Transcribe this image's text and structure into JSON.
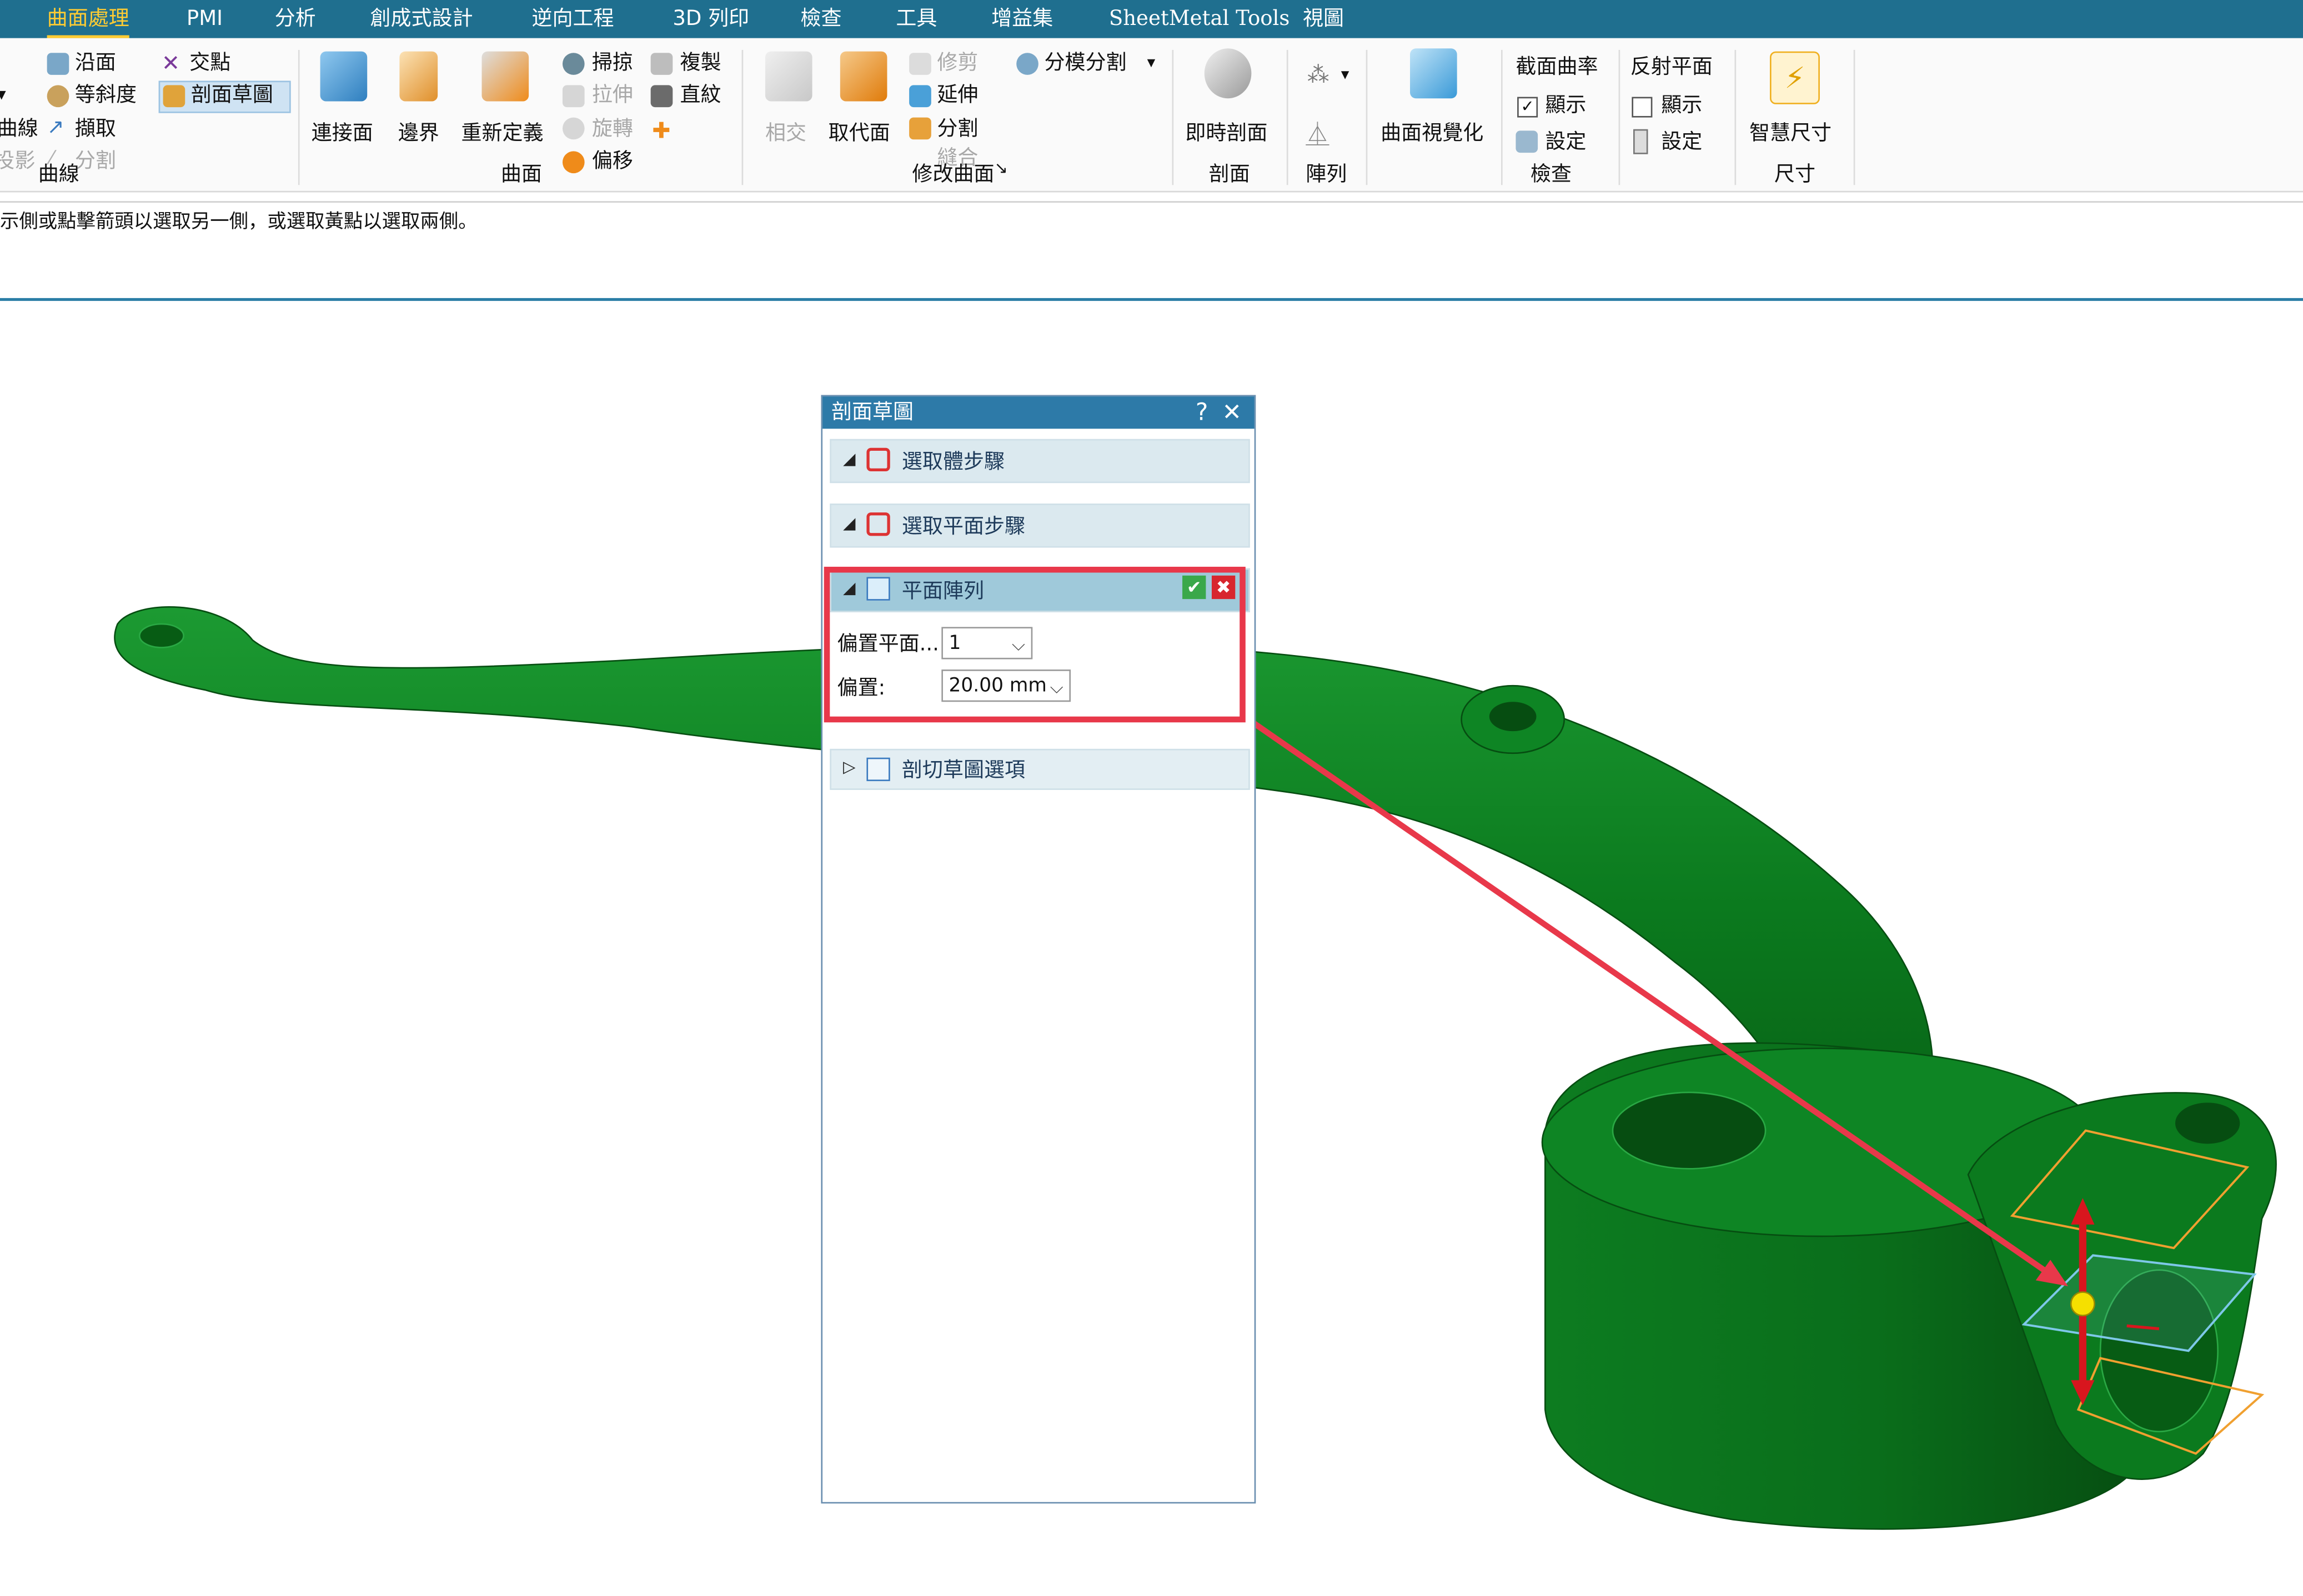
{
  "tabs": [
    "曲面處理",
    "PMI",
    "分析",
    "創成式設計",
    "逆向工程",
    "3D 列印",
    "檢查",
    "工具",
    "增益集",
    "SheetMetal Tools",
    "視圖"
  ],
  "active_tab": "曲面處理",
  "ribbon": {
    "curve_group": {
      "label": "曲線",
      "items": [
        "沿面",
        "交點",
        "等斜度",
        "剖面草圖",
        "擷取",
        "分割"
      ],
      "left_partial": [
        "曲線",
        "投影"
      ],
      "colors": {
        "highlight": "#cfe3f3"
      }
    },
    "surface_group": {
      "label": "曲面",
      "big": [
        "連接面",
        "邊界",
        "重新定義"
      ],
      "small": [
        "掃掠",
        "複製",
        "拉伸",
        "直紋",
        "旋轉",
        "偏移"
      ]
    },
    "modify_group": {
      "label": "修改曲面",
      "big": [
        "相交",
        "取代面"
      ],
      "small": [
        "修剪",
        "延伸",
        "分割",
        "縫合",
        "分模分割"
      ]
    },
    "section_group": {
      "label": "剖面",
      "big": "即時剖面"
    },
    "pattern_group": {
      "label": "陣列"
    },
    "visualize": {
      "big": "曲面視覺化"
    },
    "inspect_group": {
      "label": "檢查",
      "title": "截面曲率",
      "show": "顯示",
      "settings": "設定",
      "show_checked": true
    },
    "reflect_group": {
      "title": "反射平面",
      "show": "顯示",
      "settings": "設定",
      "show_checked": false
    },
    "dimension_group": {
      "label": "尺寸",
      "big": "智慧尺寸"
    }
  },
  "status_text": "示側或點擊箭頭以選取另一側，或選取黃點以選取兩側。",
  "dialog": {
    "title": "剖面草圖",
    "help": "?",
    "close": "✕",
    "sections": [
      {
        "label": "選取體步驟"
      },
      {
        "label": "選取平面步驟"
      },
      {
        "label": "平面陣列"
      },
      {
        "label": "剖切草圖選項"
      }
    ],
    "offset_planes_label": "偏置平面...",
    "offset_planes_value": "1",
    "offset_label": "偏置:",
    "offset_value": "20.00 mm",
    "ok": "✔",
    "cancel": "✖"
  },
  "colors": {
    "model_green": "#0b7a1e",
    "model_dark": "#075c14",
    "tabbar": "#1f6f8f",
    "annotation": "#e8384a",
    "plane": "#f0a030"
  },
  "icons": [
    "along-face-icon",
    "intersect-point-icon",
    "draft-icon",
    "section-sketch-icon",
    "extract-icon",
    "split-curve-icon",
    "blend-face-icon",
    "boundary-icon",
    "redefine-icon",
    "sweep-icon",
    "copy-icon",
    "extrude-icon",
    "ruled-icon",
    "revolve-icon",
    "offset-icon",
    "intersect-icon",
    "replace-face-icon",
    "trim-icon",
    "extend-icon",
    "split-icon",
    "stitch-icon",
    "parting-split-icon",
    "live-section-icon",
    "pattern-icon",
    "mirror-icon",
    "surface-visualize-icon",
    "smart-dimension-icon"
  ]
}
